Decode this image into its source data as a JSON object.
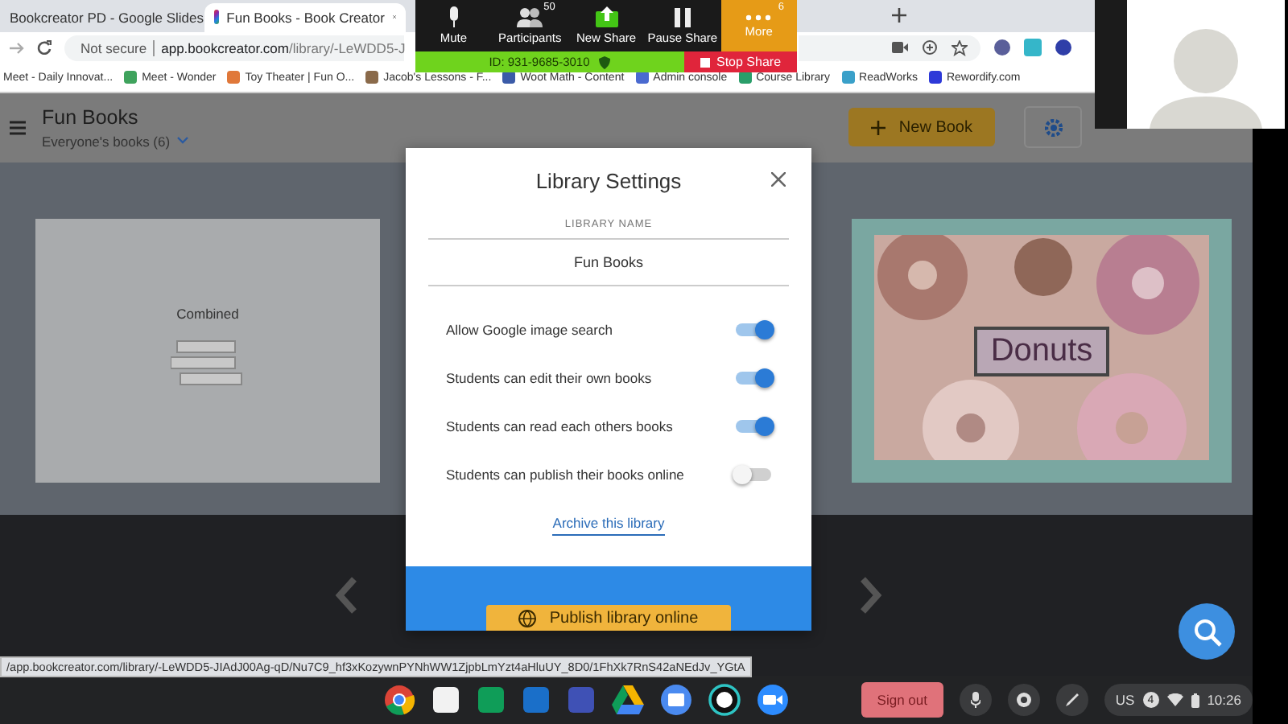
{
  "browser": {
    "tabs": [
      {
        "title": "Bookcreator PD - Google Slides",
        "selected": false
      },
      {
        "title": "Fun Books - Book Creator",
        "selected": true
      }
    ],
    "address": {
      "security": "Not secure",
      "host": "app.bookcreator.com",
      "path": "/library/-LeWDD5-J"
    },
    "bookmarks": [
      "Meet - Daily Innovat...",
      "Meet - Wonder",
      "Toy Theater | Fun O...",
      "Jacob's Lessons - F...",
      "Woot Math - Content",
      "Admin console",
      "Course Library",
      "ReadWorks",
      "Rewordify.com"
    ]
  },
  "zoom_toolbar": {
    "buttons": [
      {
        "kind": "mic",
        "label": "Mute"
      },
      {
        "kind": "people",
        "label": "Participants",
        "badge": "50"
      },
      {
        "kind": "share",
        "label": "New Share"
      },
      {
        "kind": "pause",
        "label": "Pause Share"
      },
      {
        "kind": "more",
        "label": "More",
        "badge": "6"
      }
    ],
    "meeting_id": "ID: 931-9685-3010",
    "stop_share": "Stop Share"
  },
  "app": {
    "title": "Fun Books",
    "filter": "Everyone's books (6)",
    "new_book": "New Book",
    "books": [
      {
        "kind": "text",
        "title": "Combined"
      },
      {
        "kind": "cover",
        "title": "Donuts"
      }
    ]
  },
  "dialog": {
    "title": "Library Settings",
    "name_label": "LIBRARY NAME",
    "name_value": "Fun Books",
    "settings": [
      {
        "label": "Allow Google image search",
        "on": true
      },
      {
        "label": "Students can edit their own books",
        "on": true
      },
      {
        "label": "Students can read each others books",
        "on": true
      },
      {
        "label": "Students can publish their books online",
        "on": false
      }
    ],
    "archive_link": "Archive this library",
    "publish_button": "Publish library online"
  },
  "status_url": "/app.bookcreator.com/library/-LeWDD5-JIAdJ00Ag-qD/Nu7C9_hf3xKozywnPYNhWW1ZjpbLmYzt4aHluUY_8D0/1FhXk7RnS42aNEdJv_YGtA",
  "taskbar": {
    "sign_out": "Sign out",
    "keyboard": "US",
    "notifications": "4",
    "time": "10:26"
  }
}
